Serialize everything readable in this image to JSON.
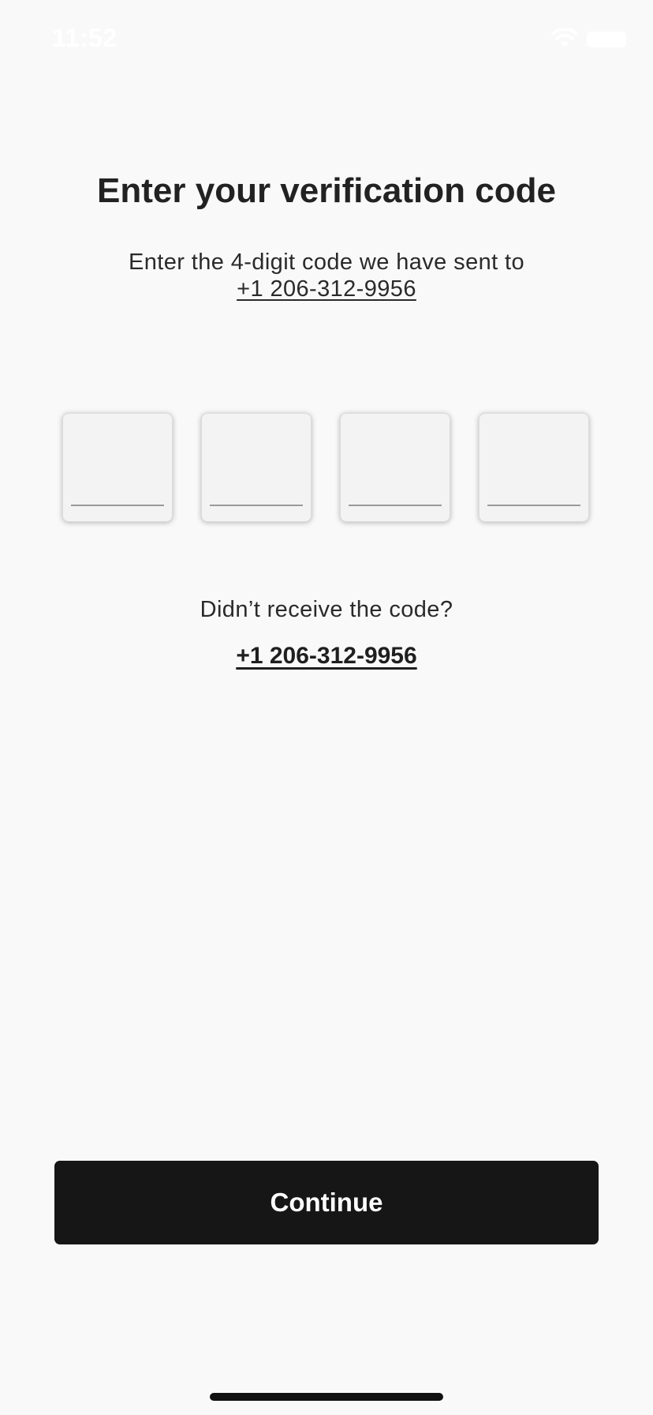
{
  "status_bar": {
    "time": "11:52",
    "wifi_icon": "wifi-icon",
    "battery_icon": "battery-icon"
  },
  "header": {
    "title": "Enter your verification code",
    "subtitle": "Enter the 4-digit code we have sent to",
    "phone": "+1 206-312-9956"
  },
  "code_inputs": {
    "count": 4,
    "values": [
      "",
      "",
      "",
      ""
    ]
  },
  "resend": {
    "question": "Didn’t receive the code?",
    "link": "+1 206-312-9956"
  },
  "actions": {
    "continue_label": "Continue"
  },
  "colors": {
    "background": "#f9f9f9",
    "button": "#161616",
    "button_text": "#ffffff",
    "text": "#1f1f1f"
  }
}
